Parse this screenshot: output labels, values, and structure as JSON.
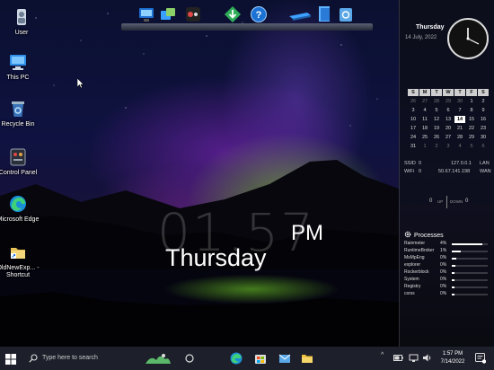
{
  "desktop_icons": [
    {
      "label": "User",
      "icon": "user-folder-icon"
    },
    {
      "label": "This PC",
      "icon": "computer-icon"
    },
    {
      "label": "Recycle Bin",
      "icon": "recycle-bin-icon"
    },
    {
      "label": "Control Panel",
      "icon": "control-panel-icon"
    },
    {
      "label": "Microsoft Edge",
      "icon": "edge-icon"
    },
    {
      "label": "OldNewExp... - Shortcut",
      "icon": "shortcut-icon"
    }
  ],
  "dock": {
    "items": [
      "monitor-icon",
      "network-icon",
      "media-icon",
      "download-icon",
      "help-icon",
      "drive-icon",
      "files-icon",
      "recycle-icon"
    ]
  },
  "big_clock": {
    "time": "01.57",
    "ampm": "PM",
    "day": "Thursday"
  },
  "sidebar": {
    "day": "Thursday",
    "date": "14 July, 2022",
    "calendar": {
      "headers": [
        "S",
        "M",
        "T",
        "W",
        "T",
        "F",
        "S"
      ],
      "rows": [
        [
          "26",
          "27",
          "28",
          "29",
          "30",
          "1",
          "2"
        ],
        [
          "3",
          "4",
          "5",
          "6",
          "7",
          "8",
          "9"
        ],
        [
          "10",
          "11",
          "12",
          "13",
          "14",
          "15",
          "16"
        ],
        [
          "17",
          "18",
          "19",
          "20",
          "21",
          "22",
          "23"
        ],
        [
          "24",
          "25",
          "26",
          "27",
          "28",
          "29",
          "30"
        ],
        [
          "31",
          "1",
          "2",
          "3",
          "4",
          "5",
          "6"
        ]
      ],
      "today": "14"
    },
    "network": {
      "ssid_label": "SSID",
      "ssid_value": "0",
      "lan_ip": "127.0.0.1",
      "lan_label": "LAN",
      "wifi_label": "WiFi",
      "wifi_value": "0",
      "wan_ip": "50.67.141.198",
      "wan_label": "WAN"
    },
    "speed": {
      "up_value": "0",
      "up_label": "UP",
      "down_label": "DOWN",
      "down_value": "0"
    },
    "processes_title": "Processes",
    "processes": [
      {
        "name": "Rainmeter",
        "pct": "4%",
        "level": 0.85
      },
      {
        "name": "RuntimeBroker",
        "pct": "1%",
        "level": 0.25
      },
      {
        "name": "MsMpEng",
        "pct": "0%",
        "level": 0.12
      },
      {
        "name": "explorer",
        "pct": "0%",
        "level": 0.1
      },
      {
        "name": "Rockerblock",
        "pct": "0%",
        "level": 0.08
      },
      {
        "name": "System",
        "pct": "0%",
        "level": 0.08
      },
      {
        "name": "Registry",
        "pct": "0%",
        "level": 0.08
      },
      {
        "name": "csrss",
        "pct": "0%",
        "level": 0.08
      }
    ]
  },
  "taskbar": {
    "search_placeholder": "Type here to search",
    "apps": [
      "cortana-icon",
      "task-view-icon",
      "edge-icon",
      "store-icon",
      "mail-icon",
      "file-explorer-icon"
    ],
    "clock_time": "1:57 PM",
    "clock_date": "7/14/2022"
  },
  "colors": {
    "aurora_green": "#8fe02a",
    "aurora_purple": "#8a3bd0",
    "taskbar": "#1d1f2a"
  }
}
